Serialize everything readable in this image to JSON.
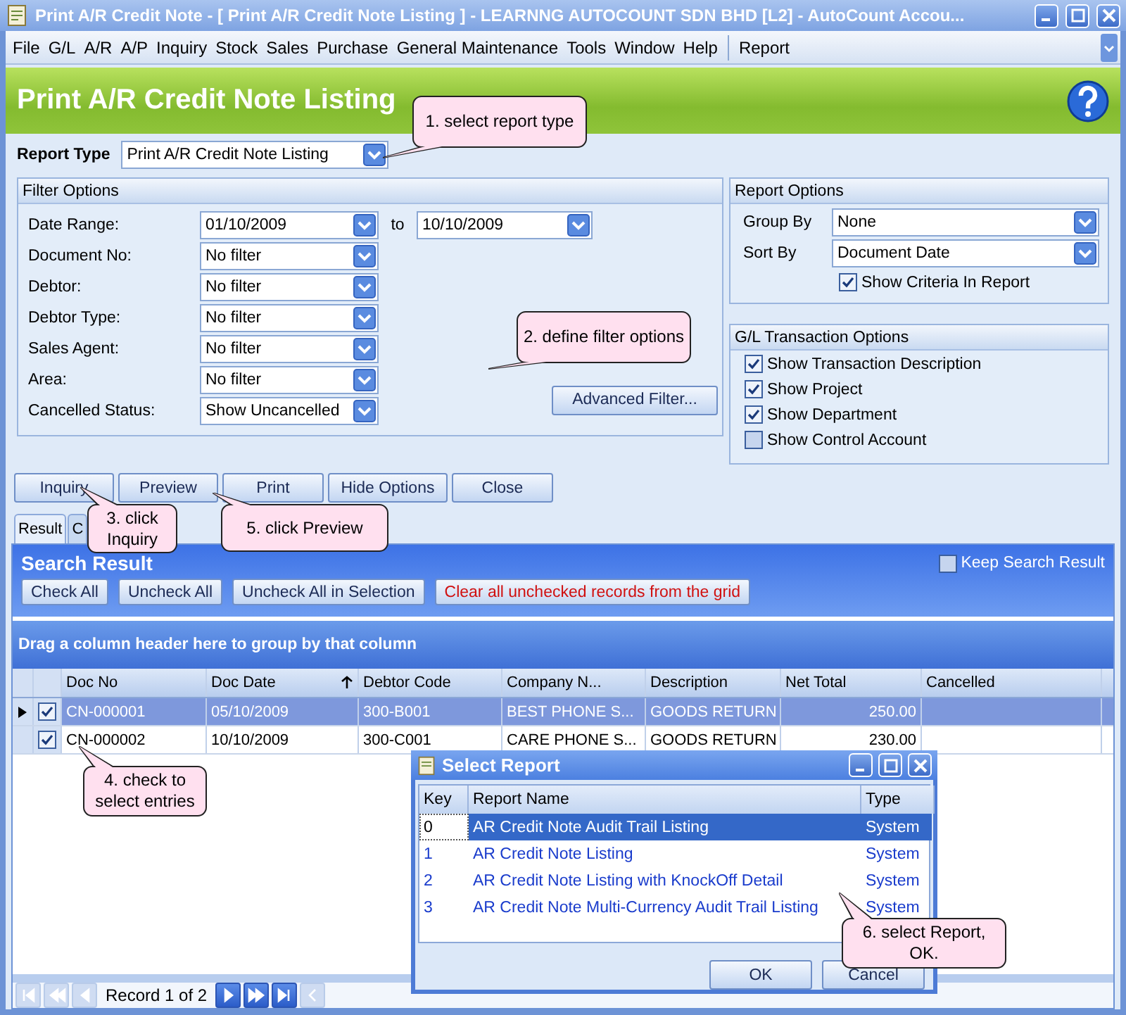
{
  "window": {
    "title": "Print A/R Credit Note - [ Print A/R Credit Note Listing ] - LEARNNG AUTOCOUNT SDN BHD [L2] - AutoCount Accou..."
  },
  "menu": [
    "File",
    "G/L",
    "A/R",
    "A/P",
    "Inquiry",
    "Stock",
    "Sales",
    "Purchase",
    "General Maintenance",
    "Tools",
    "Window",
    "Help"
  ],
  "menu_extra": [
    "Report"
  ],
  "header": {
    "title": "Print A/R Credit Note Listing"
  },
  "report_type": {
    "label": "Report Type",
    "value": "Print A/R Credit Note Listing"
  },
  "filter_options": {
    "title": "Filter Options",
    "date_range": {
      "label": "Date Range:",
      "from": "01/10/2009",
      "to_label": "to",
      "to": "10/10/2009"
    },
    "fields": [
      {
        "label": "Document No:",
        "value": "No filter"
      },
      {
        "label": "Debtor:",
        "value": "No filter"
      },
      {
        "label": "Debtor Type:",
        "value": "No filter"
      },
      {
        "label": "Sales Agent:",
        "value": "No filter"
      },
      {
        "label": "Area:",
        "value": "No filter"
      },
      {
        "label": "Cancelled Status:",
        "value": "Show Uncancelled"
      }
    ],
    "advanced_button": "Advanced Filter..."
  },
  "report_options": {
    "title": "Report Options",
    "fields": [
      {
        "label": "Group By",
        "value": "None"
      },
      {
        "label": "Sort By",
        "value": "Document Date"
      }
    ],
    "show_criteria": {
      "label": "Show Criteria In Report",
      "checked": true
    }
  },
  "gl_options": {
    "title": "G/L Transaction Options",
    "items": [
      {
        "label": "Show Transaction Description",
        "checked": true
      },
      {
        "label": "Show Project",
        "checked": true
      },
      {
        "label": "Show Department",
        "checked": true
      },
      {
        "label": "Show Control Account",
        "checked": false
      }
    ]
  },
  "actions": [
    "Inquiry",
    "Preview",
    "Print",
    "Hide Options",
    "Close"
  ],
  "tabs": [
    {
      "label": "Result",
      "selected": true
    },
    {
      "label": "C",
      "selected": false
    }
  ],
  "search_result": {
    "title": "Search Result",
    "keep": {
      "label": "Keep Search Result",
      "checked": false
    },
    "buttons": [
      {
        "label": "Check All",
        "kind": "normal"
      },
      {
        "label": "Uncheck All",
        "kind": "normal"
      },
      {
        "label": "Uncheck All in Selection",
        "kind": "normal"
      },
      {
        "label": "Clear all unchecked records from the grid",
        "kind": "danger"
      }
    ],
    "group_hint": "Drag a column header here to group by that column",
    "columns": [
      {
        "label": "Doc No",
        "kind": "text",
        "sorted": false
      },
      {
        "label": "Doc Date",
        "kind": "text",
        "sorted": true
      },
      {
        "label": "Debtor Code",
        "kind": "text",
        "sorted": false
      },
      {
        "label": "Company N...",
        "kind": "text",
        "sorted": false
      },
      {
        "label": "Description",
        "kind": "text",
        "sorted": false
      },
      {
        "label": "Net Total",
        "kind": "number",
        "sorted": false
      },
      {
        "label": "Cancelled",
        "kind": "text",
        "sorted": false
      }
    ],
    "rows": [
      {
        "selected": true,
        "checked": true,
        "cells": [
          "CN-000001",
          "05/10/2009",
          "300-B001",
          "BEST PHONE S...",
          "GOODS RETURN",
          "250.00",
          ""
        ]
      },
      {
        "selected": false,
        "checked": true,
        "cells": [
          "CN-000002",
          "10/10/2009",
          "300-C001",
          "CARE PHONE S...",
          "GOODS RETURN",
          "230.00",
          ""
        ]
      }
    ],
    "navigator": {
      "record": "Record 1 of 2"
    }
  },
  "dialog": {
    "title": "Select Report",
    "columns": [
      "Key",
      "Report Name",
      "Type"
    ],
    "rows": [
      {
        "key": "0",
        "name": "AR Credit Note Audit Trail Listing",
        "type": "System",
        "selected": true
      },
      {
        "key": "1",
        "name": "AR Credit Note Listing",
        "type": "System",
        "selected": false
      },
      {
        "key": "2",
        "name": "AR Credit Note Listing with KnockOff Detail",
        "type": "System",
        "selected": false
      },
      {
        "key": "3",
        "name": "AR Credit Note Multi-Currency Audit Trail Listing",
        "type": "System",
        "selected": false
      }
    ],
    "buttons": [
      "OK",
      "Cancel"
    ]
  },
  "callouts": [
    {
      "text": "1. select report type"
    },
    {
      "text": "2. define filter options"
    },
    {
      "text": "3. click Inquiry"
    },
    {
      "text": "4. check to select entries"
    },
    {
      "text": "5. click Preview"
    },
    {
      "text": "6. select Report, OK."
    }
  ]
}
